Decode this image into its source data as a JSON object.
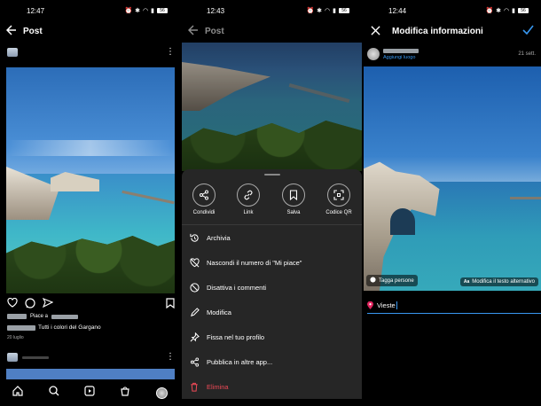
{
  "panel1": {
    "status": {
      "time": "12:47",
      "battery": "56"
    },
    "title": "Post",
    "likes_text": "Piace a",
    "caption": "Tutti i colori del Gargano",
    "date": "20 luglio"
  },
  "panel2": {
    "status": {
      "time": "12:43",
      "battery": "56"
    },
    "title": "Post",
    "actions": [
      {
        "label": "Condividi",
        "icon": "share-icon"
      },
      {
        "label": "Link",
        "icon": "link-icon"
      },
      {
        "label": "Salva",
        "icon": "bookmark-icon"
      },
      {
        "label": "Codice QR",
        "icon": "qr-code-icon"
      }
    ],
    "menu": [
      {
        "label": "Archivia",
        "icon": "archive-icon"
      },
      {
        "label": "Nascondi il numero di \"Mi piace\"",
        "icon": "hide-likes-icon"
      },
      {
        "label": "Disattiva i commenti",
        "icon": "comments-off-icon"
      },
      {
        "label": "Modifica",
        "icon": "edit-icon"
      },
      {
        "label": "Fissa nel tuo profilo",
        "icon": "pin-icon"
      },
      {
        "label": "Pubblica in altre app...",
        "icon": "share-network-icon"
      },
      {
        "label": "Elimina",
        "icon": "trash-icon"
      }
    ],
    "delete_color": "#ed4956"
  },
  "panel3": {
    "status": {
      "time": "12:44",
      "battery": "56"
    },
    "title": "Modifica informazioni",
    "add_location": "Aggiungi luogo",
    "date": "21 sett.",
    "tag_people": "Tagga persone",
    "alt_text": "Modifica il testo alternativo",
    "alt_badge": "Aa",
    "location_value": "Vieste",
    "accent_color": "#3897f0"
  }
}
